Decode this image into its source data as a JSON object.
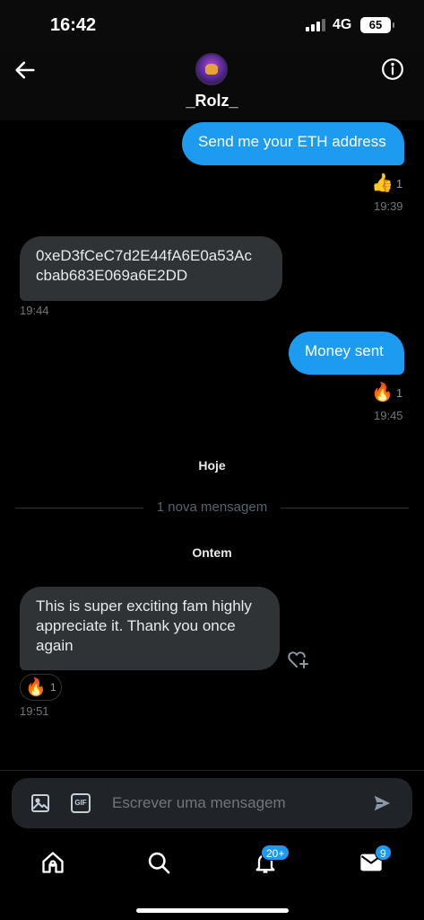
{
  "status_bar": {
    "time": "16:42",
    "network": "4G",
    "battery": "65"
  },
  "header": {
    "contact_name": "_Rolz_",
    "back_icon": "arrow-left-icon",
    "info_icon": "info-circle-icon"
  },
  "messages": [
    {
      "direction": "outgoing",
      "text": "Send me your ETH address",
      "reaction": {
        "emoji": "👍",
        "count": "1"
      },
      "time": "19:39"
    },
    {
      "direction": "incoming",
      "line1": "0xeD3fCeC7d2E44fA6E0a53Ac",
      "line2": "cbab683E069a6E2DD",
      "time": "19:44"
    },
    {
      "direction": "outgoing",
      "text": "Money sent",
      "reaction": {
        "emoji": "🔥",
        "count": "1"
      },
      "time": "19:45"
    },
    {
      "direction": "incoming",
      "line1": "This is super exciting fam highly",
      "line2": "appreciate it. Thank you once",
      "line3": "again",
      "reaction": {
        "emoji": "🔥",
        "count": "1"
      },
      "time": "19:51"
    }
  ],
  "separators": {
    "today": "Hoje",
    "new_messages": "1 nova mensagem",
    "yesterday": "Ontem"
  },
  "composer": {
    "placeholder": "Escrever uma mensagem",
    "gif_label": "GIF"
  },
  "tabbar": {
    "notifications_badge": "20+",
    "messages_badge": "9"
  },
  "colors": {
    "accent": "#1d9bf0",
    "incoming_bubble": "#2f3336",
    "background": "#000000"
  }
}
